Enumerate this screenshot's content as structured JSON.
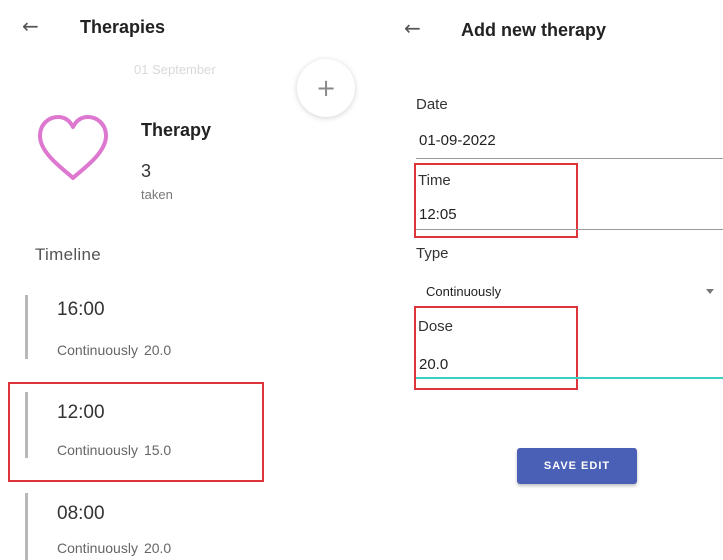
{
  "left": {
    "title": "Therapies",
    "date": "01 September",
    "add_glyph": "+",
    "summary": {
      "icon": "heart-icon",
      "label": "Therapy",
      "count": "3",
      "status": "taken"
    },
    "timeline_title": "Timeline",
    "timeline": [
      {
        "time": "16:00",
        "type": "Continuously",
        "dose": "20.0"
      },
      {
        "time": "12:00",
        "type": "Continuously",
        "dose": "15.0"
      },
      {
        "time": "08:00",
        "type": "Continuously",
        "dose": "20.0"
      }
    ]
  },
  "right": {
    "title": "Add new therapy",
    "fields": {
      "date": {
        "label": "Date",
        "value": "01-09-2022"
      },
      "time": {
        "label": "Time",
        "value": "12:05"
      },
      "type": {
        "label": "Type",
        "value": "Continuously"
      },
      "dose": {
        "label": "Dose",
        "value": "20.0"
      }
    },
    "save_label": "SAVE EDIT"
  },
  "colors": {
    "accent_heart": "#dd77cf",
    "highlight": "#e0343b",
    "active_underline": "#3dcfc1",
    "button": "#4a5fb6"
  }
}
